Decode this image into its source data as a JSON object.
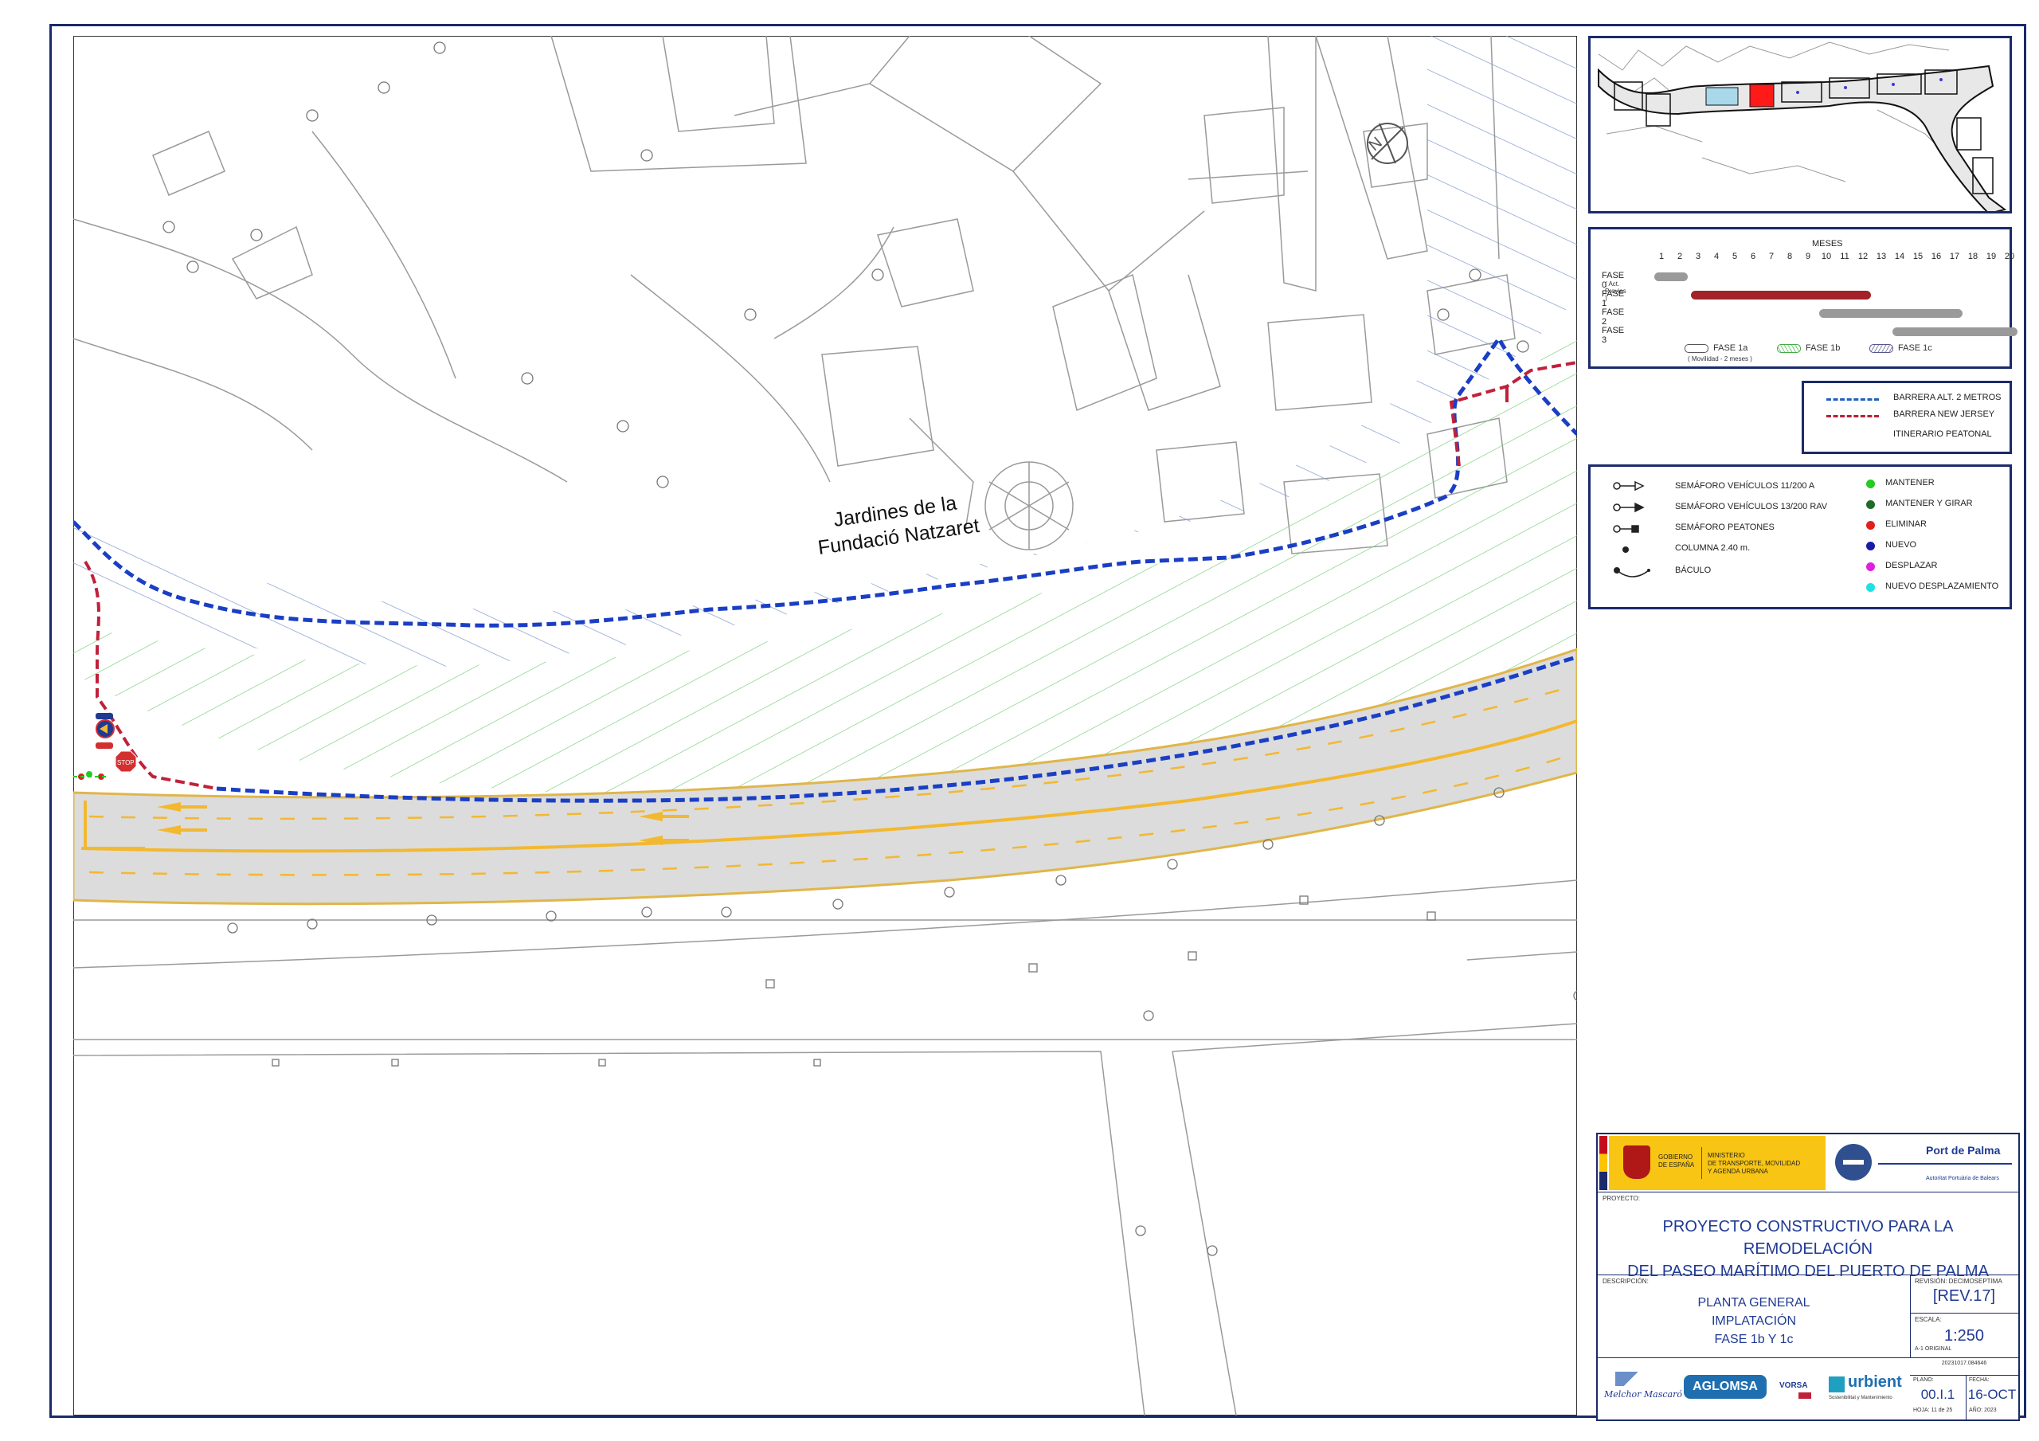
{
  "map": {
    "place_label_line1": "Jardines de la",
    "place_label_line2": "Fundació Natzaret"
  },
  "gantt": {
    "header": "MESES",
    "months": [
      "1",
      "2",
      "3",
      "4",
      "5",
      "6",
      "7",
      "8",
      "9",
      "10",
      "11",
      "12",
      "13",
      "14",
      "15",
      "16",
      "17",
      "18",
      "19",
      "20"
    ],
    "phases": [
      {
        "label": "FASE 0",
        "sublabel": "( Act. Previas )",
        "start": 1,
        "end": 2,
        "color": "#9a9a9a"
      },
      {
        "label": "FASE 1",
        "sublabel": "",
        "start": 3,
        "end": 12,
        "color": "#a3222a"
      },
      {
        "label": "FASE 2",
        "sublabel": "",
        "start": 10,
        "end": 17,
        "color": "#9a9a9a"
      },
      {
        "label": "FASE 3",
        "sublabel": "",
        "start": 14,
        "end": 20,
        "color": "#9a9a9a"
      }
    ],
    "legend": [
      {
        "label": "FASE 1a",
        "note": "( Movilidad - 2 meses )"
      },
      {
        "label": "FASE 1b",
        "note": ""
      },
      {
        "label": "FASE 1c",
        "note": ""
      }
    ]
  },
  "barrier_legend": [
    {
      "label": "BARRERA ALT. 2 METROS",
      "color": "#1f5fbf"
    },
    {
      "label": "BARRERA NEW JERSEY",
      "color": "#b3203a"
    },
    {
      "label": "ITINERARIO  PEATONAL",
      "color": ""
    }
  ],
  "symbols_legend": {
    "left": [
      {
        "icon": "vehicle-signal-icon",
        "label": "SEMÁFORO VEHÍCULOS 11/200 A"
      },
      {
        "icon": "vehicle-signal-rav-icon",
        "label": "SEMÁFORO VEHÍCULOS 13/200 RAV"
      },
      {
        "icon": "pedestrian-signal-icon",
        "label": "SEMÁFORO PEATONES"
      },
      {
        "icon": "column-icon",
        "label": "COLUMNA 2.40 m."
      },
      {
        "icon": "lamp-post-icon",
        "label": "BÁCULO"
      }
    ],
    "right": [
      {
        "label": "MANTENER",
        "color": "#22cc22"
      },
      {
        "label": "MANTENER Y GIRAR",
        "color": "#1f6b2a"
      },
      {
        "label": "ELIMINAR",
        "color": "#e02020"
      },
      {
        "label": "NUEVO",
        "color": "#1a1aa8"
      },
      {
        "label": "DESPLAZAR",
        "color": "#e020e0"
      },
      {
        "label": "NUEVO DESPLAZAMIENTO",
        "color": "#20e0e0"
      }
    ]
  },
  "title_block": {
    "gov_line1": "GOBIERNO",
    "gov_line2": "DE ESPAÑA",
    "ministry_line1": "MINISTERIO",
    "ministry_line2": "DE TRANSPORTE, MOVILIDAD",
    "ministry_line3": "Y AGENDA URBANA",
    "port_name": "Port de Palma",
    "port_sub": "Autoritat Portuària de Balears",
    "project_label": "PROYECTO:",
    "project_line1": "PROYECTO CONSTRUCTIVO PARA LA REMODELACIÓN",
    "project_line2": "DEL PASEO MARÍTIMO DEL PUERTO DE PALMA",
    "description_label": "DESCRIPCIÓN:",
    "description_line1": "PLANTA GENERAL",
    "description_line2": "IMPLATACIÓN",
    "description_line3": "FASE 1b Y 1c",
    "revision_label": "REVISIÓN: DECIMOSEPTIMA",
    "revision_value": "[REV.17]",
    "scale_label": "ESCALA:",
    "scale_value": "1:250",
    "scale_note": "A-1 ORIGINAL",
    "file_code": "20231017.084646",
    "plano_label": "PLANO:",
    "plano_value": "00.I.1",
    "hoja_label": "HOJA:",
    "hoja_value": "11 de 25",
    "fecha_label": "FECHA:",
    "fecha_value": "16-OCT",
    "year_label": "AÑO:",
    "year_value": "2023",
    "logos": [
      "Melchor Mascaró",
      "AGLOMSA",
      "VORSA",
      "urbient"
    ],
    "urbient_sub": "Sostenibilitat y Mantenimiento"
  }
}
